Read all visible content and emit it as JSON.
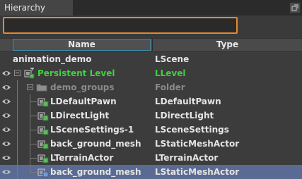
{
  "panel": {
    "title": "Hierarchy"
  },
  "search": {
    "value": "",
    "placeholder": ""
  },
  "columns": {
    "name": "Name",
    "type": "Type"
  },
  "rows": [
    {
      "name": "animation_demo",
      "type": "LScene",
      "icon": "scene",
      "color": "normal"
    },
    {
      "name": "Persistent Level",
      "type": "LLevel",
      "icon": "level-icon",
      "color": "green"
    },
    {
      "name": "demo_groups",
      "type": "Folder",
      "icon": "folder-icon",
      "color": "dim"
    },
    {
      "name": "LDefaultPawn",
      "type": "LDefaultPawn",
      "icon": "actor-icon",
      "color": "normal"
    },
    {
      "name": "LDirectLight",
      "type": "LDirectLight",
      "icon": "actor-icon",
      "color": "normal"
    },
    {
      "name": "LSceneSettings-1",
      "type": "LSceneSettings",
      "icon": "actor-icon",
      "color": "normal"
    },
    {
      "name": "back_ground_mesh",
      "type": "LStaticMeshActor",
      "icon": "actor-icon",
      "color": "normal"
    },
    {
      "name": "LTerrainActor",
      "type": "LTerrainActor",
      "icon": "actor-icon",
      "color": "normal"
    },
    {
      "name": "back_ground_mesh",
      "type": "LStaticMeshActor",
      "icon": "actor-icon",
      "color": "normal",
      "selected": true
    }
  ],
  "colors": {
    "search_border": "#e6892d",
    "selection": "#5a6b93",
    "level_text": "#3fd13f",
    "folder_text": "#8a8a8a"
  }
}
